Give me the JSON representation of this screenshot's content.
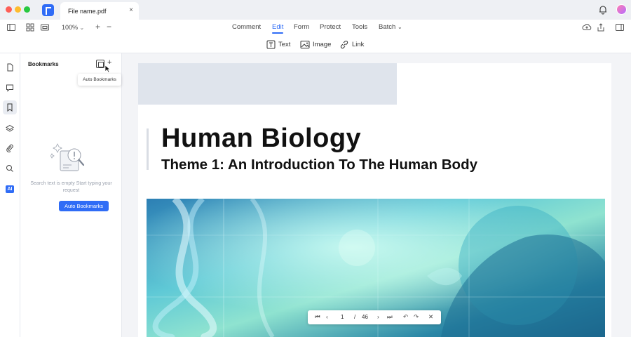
{
  "window": {
    "tab_title": "File name.pdf",
    "tab_close": "×"
  },
  "toolbar": {
    "zoom": "100%",
    "zoom_in": "+",
    "zoom_out": "−",
    "menu": [
      "Comment",
      "Edit",
      "Form",
      "Protect",
      "Tools",
      "Batch"
    ],
    "active_menu": "Edit",
    "batch_suffix": "⌄",
    "edit_tools": [
      "Text",
      "Image",
      "Link"
    ]
  },
  "rail": {
    "ai_badge": "AI"
  },
  "bookmarks": {
    "title": "Bookmarks",
    "add": "+",
    "tooltip": "Auto Bookmarks",
    "empty_text": "Search text is empty Start typing your request",
    "button": "Auto Bookmarks"
  },
  "document": {
    "title": "Human Biology",
    "subtitle": "Theme 1: An Introduction To The Human Body"
  },
  "pagenav": {
    "current_page": "1",
    "separator": "/",
    "total_pages": "46"
  },
  "colors": {
    "accent": "#2f6cf6",
    "header_block": "#dfe4ec",
    "hero_base": "#1f6e9a"
  },
  "icons": [
    "bell-icon",
    "avatar",
    "sidebar-toggle-icon",
    "grid-icon",
    "thumbnail-icon",
    "upload-icon",
    "share-icon",
    "panel-icon",
    "file-icon",
    "comment-icon",
    "bookmark-icon",
    "layers-icon",
    "attachment-icon",
    "search-icon"
  ]
}
